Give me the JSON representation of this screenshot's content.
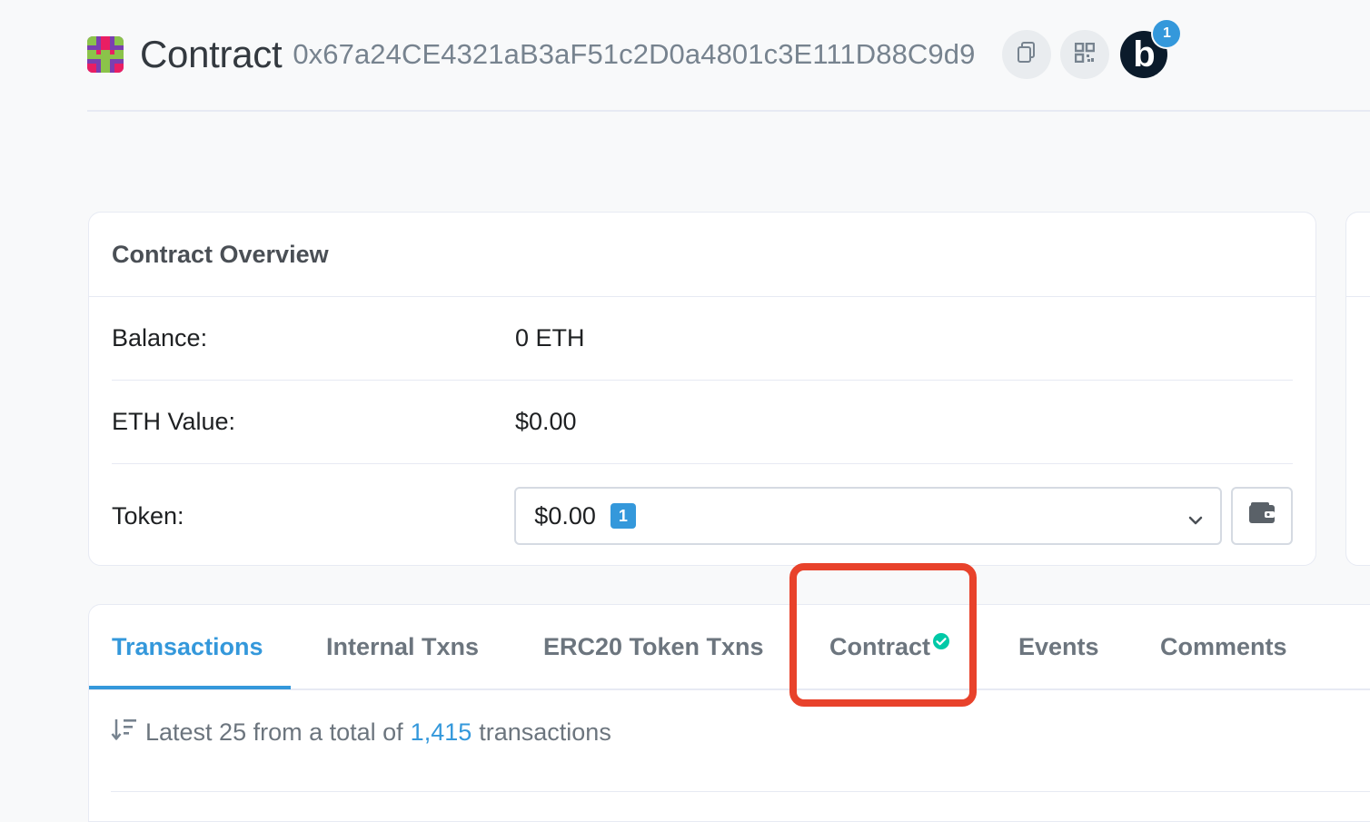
{
  "header": {
    "title": "Contract",
    "address": "0x67a24CE4321aB3aF51c2D0a4801c3E111D88C9d9",
    "icons": [
      "identicon",
      "copy-icon",
      "qr-code-icon",
      "b-avatar-icon"
    ],
    "avatar_letter": "b",
    "notification_count": "1"
  },
  "overview": {
    "title": "Contract Overview",
    "rows": [
      {
        "label": "Balance:",
        "value": "0 ETH"
      },
      {
        "label": "ETH Value:",
        "value": "$0.00"
      },
      {
        "label": "Token:",
        "value": "$0.00"
      }
    ],
    "token_count": "1",
    "icons": [
      "chevron-down-icon",
      "wallet-icon"
    ]
  },
  "tabs": {
    "items": [
      "Transactions",
      "Internal Txns",
      "ERC20 Token Txns",
      "Contract",
      "Events",
      "Comments"
    ],
    "active": "Transactions",
    "verified_icon": "check-circle-icon"
  },
  "summary": {
    "prefix": "Latest 25 from a total of",
    "count": "1,415",
    "suffix": "transactions",
    "icon": "sort-desc-icon"
  },
  "colors": {
    "accent": "#3498db",
    "highlight": "#e8422b",
    "verified": "#00c9a7",
    "avatar_bg": "#0b1b2b"
  }
}
